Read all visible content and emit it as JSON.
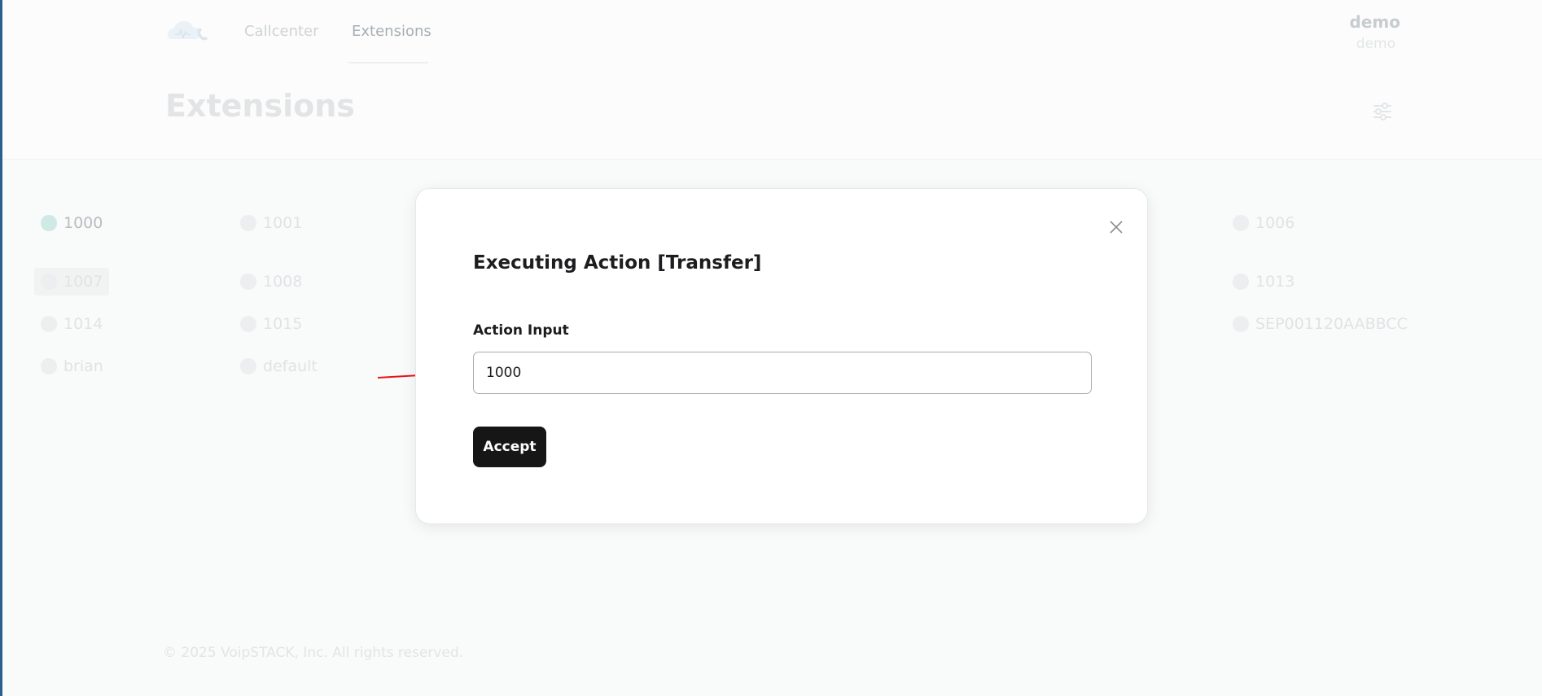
{
  "nav": {
    "items": [
      "Callcenter",
      "Extensions"
    ],
    "active": "Extensions"
  },
  "user": {
    "name": "demo",
    "sub": "demo"
  },
  "page": {
    "title": "Extensions"
  },
  "extensions": {
    "row1": [
      "1000",
      "1001",
      "1006"
    ],
    "row2": [
      "1007",
      "1008",
      "1013"
    ],
    "row3": [
      "1014",
      "1015",
      "SEP001120AABBCC"
    ],
    "row4": [
      "brian",
      "default"
    ]
  },
  "footer": {
    "text": "© 2025 VoipSTACK, Inc. All rights reserved."
  },
  "modal": {
    "title": "Executing Action [Transfer]",
    "field_label": "Action Input",
    "input_value": "1000",
    "accept_label": "Accept"
  },
  "colors": {
    "accent_dark": "#161616",
    "online": "#cfe9e4",
    "annotation_arrow": "#e8141b"
  }
}
